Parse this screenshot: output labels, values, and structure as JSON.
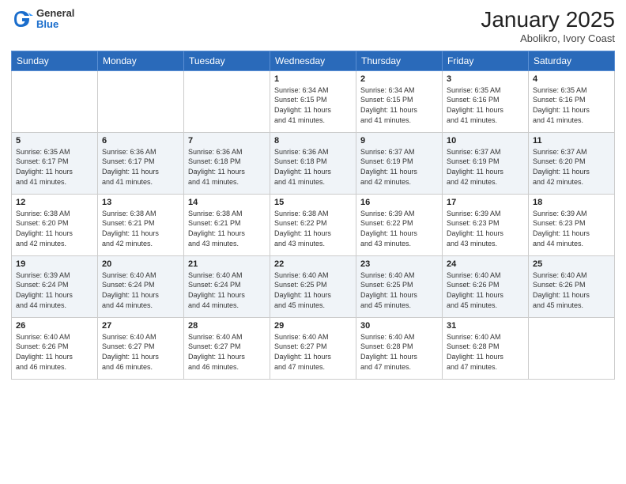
{
  "header": {
    "logo_general": "General",
    "logo_blue": "Blue",
    "month_title": "January 2025",
    "location": "Abolikro, Ivory Coast"
  },
  "days_of_week": [
    "Sunday",
    "Monday",
    "Tuesday",
    "Wednesday",
    "Thursday",
    "Friday",
    "Saturday"
  ],
  "weeks": [
    [
      {
        "num": "",
        "info": ""
      },
      {
        "num": "",
        "info": ""
      },
      {
        "num": "",
        "info": ""
      },
      {
        "num": "1",
        "info": "Sunrise: 6:34 AM\nSunset: 6:15 PM\nDaylight: 11 hours\nand 41 minutes."
      },
      {
        "num": "2",
        "info": "Sunrise: 6:34 AM\nSunset: 6:15 PM\nDaylight: 11 hours\nand 41 minutes."
      },
      {
        "num": "3",
        "info": "Sunrise: 6:35 AM\nSunset: 6:16 PM\nDaylight: 11 hours\nand 41 minutes."
      },
      {
        "num": "4",
        "info": "Sunrise: 6:35 AM\nSunset: 6:16 PM\nDaylight: 11 hours\nand 41 minutes."
      }
    ],
    [
      {
        "num": "5",
        "info": "Sunrise: 6:35 AM\nSunset: 6:17 PM\nDaylight: 11 hours\nand 41 minutes."
      },
      {
        "num": "6",
        "info": "Sunrise: 6:36 AM\nSunset: 6:17 PM\nDaylight: 11 hours\nand 41 minutes."
      },
      {
        "num": "7",
        "info": "Sunrise: 6:36 AM\nSunset: 6:18 PM\nDaylight: 11 hours\nand 41 minutes."
      },
      {
        "num": "8",
        "info": "Sunrise: 6:36 AM\nSunset: 6:18 PM\nDaylight: 11 hours\nand 41 minutes."
      },
      {
        "num": "9",
        "info": "Sunrise: 6:37 AM\nSunset: 6:19 PM\nDaylight: 11 hours\nand 42 minutes."
      },
      {
        "num": "10",
        "info": "Sunrise: 6:37 AM\nSunset: 6:19 PM\nDaylight: 11 hours\nand 42 minutes."
      },
      {
        "num": "11",
        "info": "Sunrise: 6:37 AM\nSunset: 6:20 PM\nDaylight: 11 hours\nand 42 minutes."
      }
    ],
    [
      {
        "num": "12",
        "info": "Sunrise: 6:38 AM\nSunset: 6:20 PM\nDaylight: 11 hours\nand 42 minutes."
      },
      {
        "num": "13",
        "info": "Sunrise: 6:38 AM\nSunset: 6:21 PM\nDaylight: 11 hours\nand 42 minutes."
      },
      {
        "num": "14",
        "info": "Sunrise: 6:38 AM\nSunset: 6:21 PM\nDaylight: 11 hours\nand 43 minutes."
      },
      {
        "num": "15",
        "info": "Sunrise: 6:38 AM\nSunset: 6:22 PM\nDaylight: 11 hours\nand 43 minutes."
      },
      {
        "num": "16",
        "info": "Sunrise: 6:39 AM\nSunset: 6:22 PM\nDaylight: 11 hours\nand 43 minutes."
      },
      {
        "num": "17",
        "info": "Sunrise: 6:39 AM\nSunset: 6:23 PM\nDaylight: 11 hours\nand 43 minutes."
      },
      {
        "num": "18",
        "info": "Sunrise: 6:39 AM\nSunset: 6:23 PM\nDaylight: 11 hours\nand 44 minutes."
      }
    ],
    [
      {
        "num": "19",
        "info": "Sunrise: 6:39 AM\nSunset: 6:24 PM\nDaylight: 11 hours\nand 44 minutes."
      },
      {
        "num": "20",
        "info": "Sunrise: 6:40 AM\nSunset: 6:24 PM\nDaylight: 11 hours\nand 44 minutes."
      },
      {
        "num": "21",
        "info": "Sunrise: 6:40 AM\nSunset: 6:24 PM\nDaylight: 11 hours\nand 44 minutes."
      },
      {
        "num": "22",
        "info": "Sunrise: 6:40 AM\nSunset: 6:25 PM\nDaylight: 11 hours\nand 45 minutes."
      },
      {
        "num": "23",
        "info": "Sunrise: 6:40 AM\nSunset: 6:25 PM\nDaylight: 11 hours\nand 45 minutes."
      },
      {
        "num": "24",
        "info": "Sunrise: 6:40 AM\nSunset: 6:26 PM\nDaylight: 11 hours\nand 45 minutes."
      },
      {
        "num": "25",
        "info": "Sunrise: 6:40 AM\nSunset: 6:26 PM\nDaylight: 11 hours\nand 45 minutes."
      }
    ],
    [
      {
        "num": "26",
        "info": "Sunrise: 6:40 AM\nSunset: 6:26 PM\nDaylight: 11 hours\nand 46 minutes."
      },
      {
        "num": "27",
        "info": "Sunrise: 6:40 AM\nSunset: 6:27 PM\nDaylight: 11 hours\nand 46 minutes."
      },
      {
        "num": "28",
        "info": "Sunrise: 6:40 AM\nSunset: 6:27 PM\nDaylight: 11 hours\nand 46 minutes."
      },
      {
        "num": "29",
        "info": "Sunrise: 6:40 AM\nSunset: 6:27 PM\nDaylight: 11 hours\nand 47 minutes."
      },
      {
        "num": "30",
        "info": "Sunrise: 6:40 AM\nSunset: 6:28 PM\nDaylight: 11 hours\nand 47 minutes."
      },
      {
        "num": "31",
        "info": "Sunrise: 6:40 AM\nSunset: 6:28 PM\nDaylight: 11 hours\nand 47 minutes."
      },
      {
        "num": "",
        "info": ""
      }
    ]
  ]
}
